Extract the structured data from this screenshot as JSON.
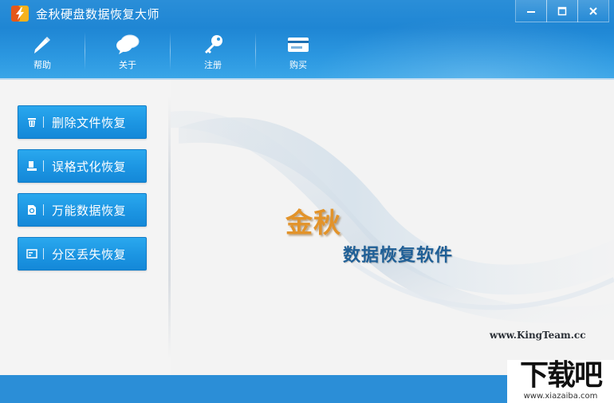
{
  "window": {
    "title": "金秋硬盘数据恢复大师",
    "controls": [
      "minimize",
      "maximize",
      "close"
    ]
  },
  "toolbar": {
    "items": [
      {
        "label": "帮助",
        "icon": "help-pen-icon"
      },
      {
        "label": "关于",
        "icon": "chat-bubbles-icon"
      },
      {
        "label": "注册",
        "icon": "key-icon"
      },
      {
        "label": "购买",
        "icon": "card-icon"
      }
    ]
  },
  "functions": [
    {
      "label": "删除文件恢复",
      "icon": "trash-icon"
    },
    {
      "label": "误格式化恢复",
      "icon": "format-icon"
    },
    {
      "label": "万能数据恢复",
      "icon": "document-search-icon"
    },
    {
      "label": "分区丢失恢复",
      "icon": "partition-icon"
    }
  ],
  "splash": {
    "brand": "金秋",
    "subtitle": "数据恢复软件",
    "url": "www.KingTeam.cc"
  },
  "watermark": {
    "text": "下载吧",
    "url": "www.xiazaiba.com"
  },
  "colors": {
    "header": "#1f86d4",
    "button": "#1c95e2",
    "brand": "#e2932a",
    "subtitle": "#1f5f96"
  }
}
